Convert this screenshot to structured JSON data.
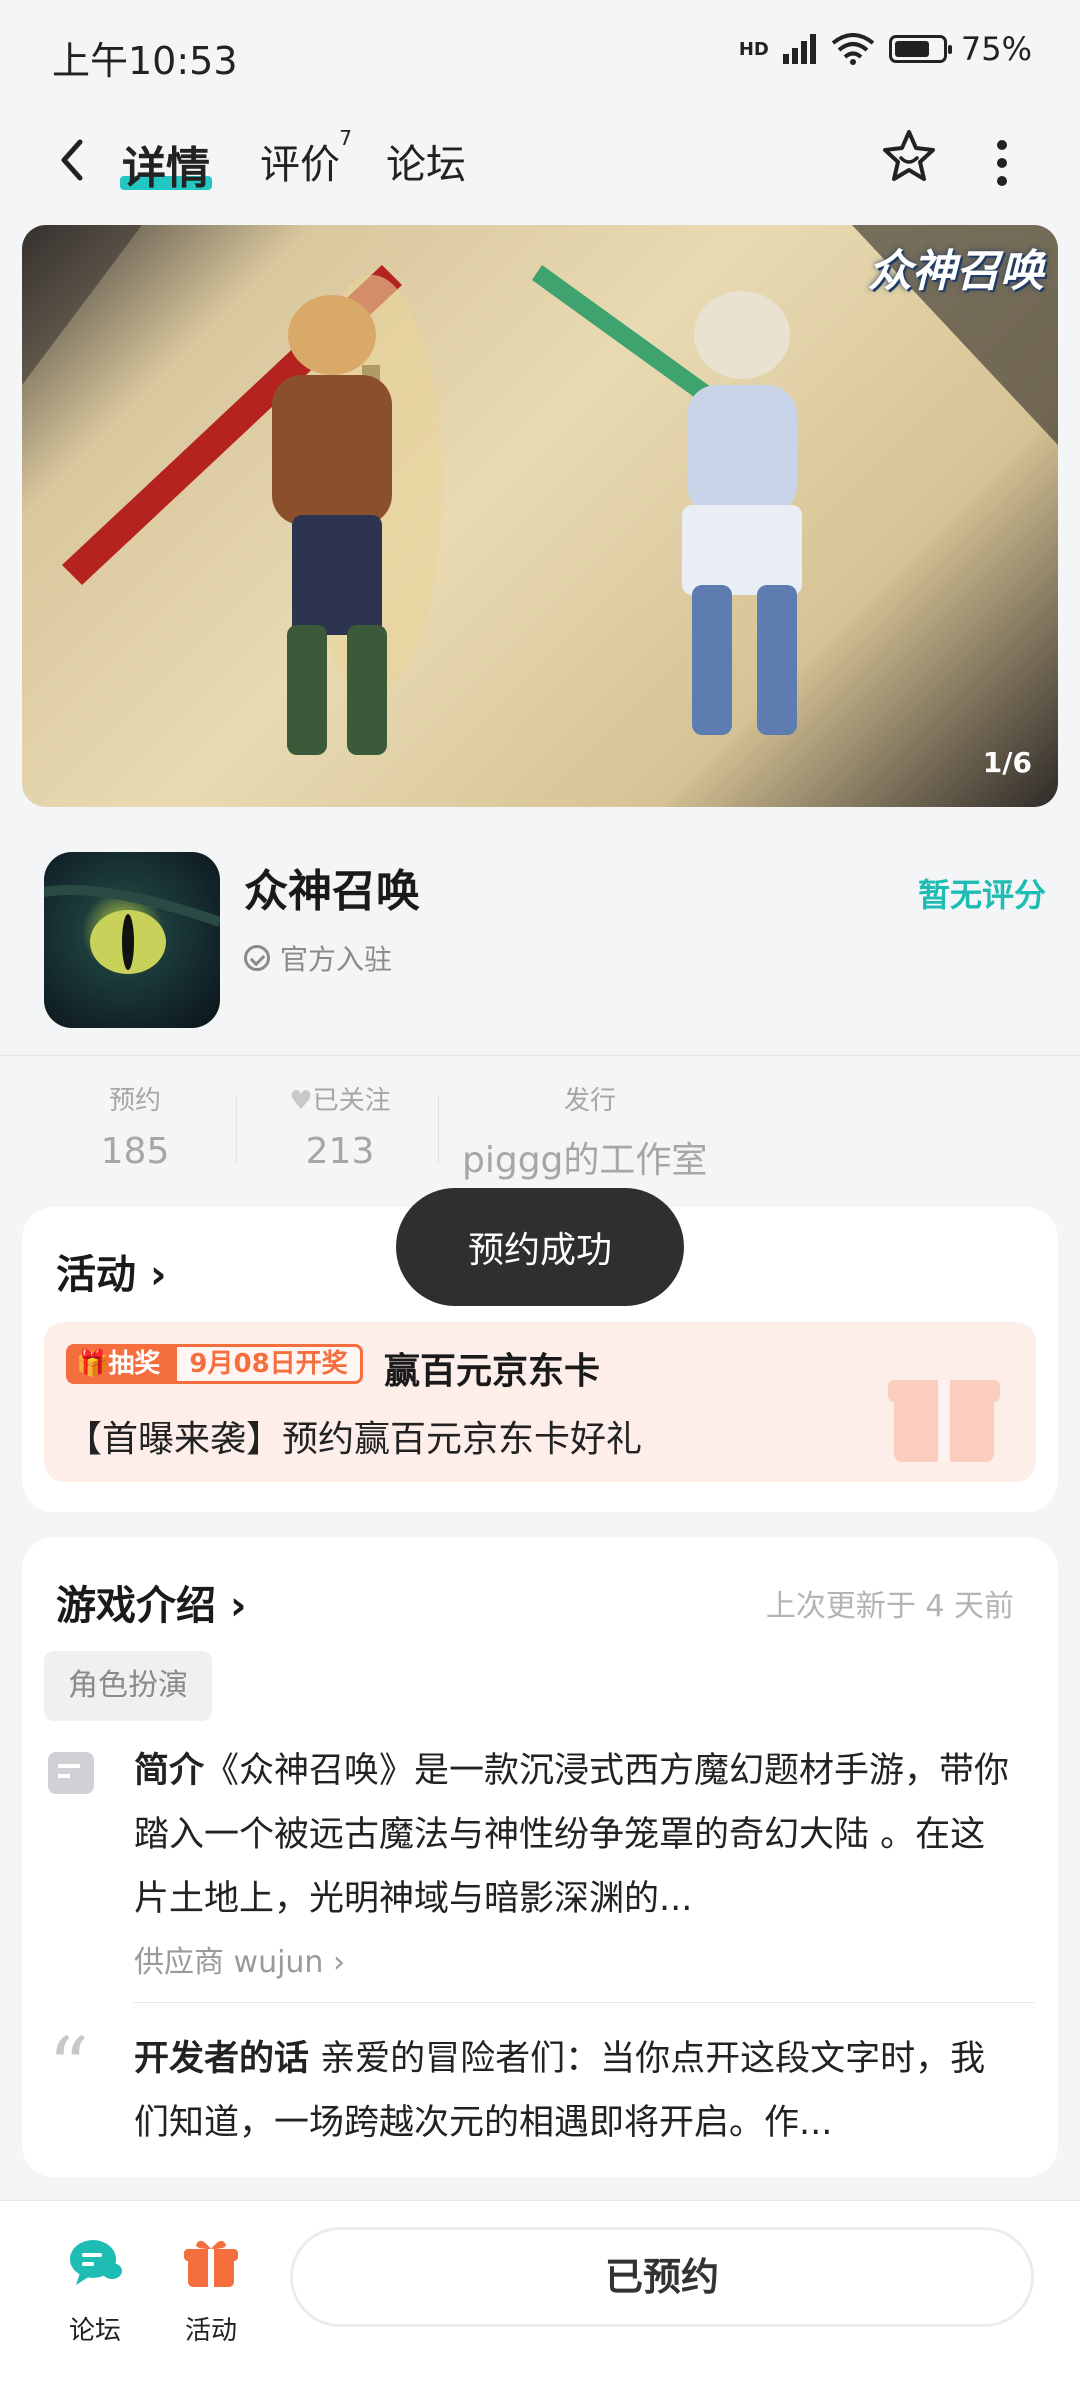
{
  "status": {
    "time": "上午10:53",
    "network": "HD",
    "battery": "75%",
    "battery_level": 0.75
  },
  "nav": {
    "tabs": [
      {
        "label": "详情",
        "active": true
      },
      {
        "label": "评价",
        "badge": "7"
      },
      {
        "label": "论坛"
      }
    ]
  },
  "banner": {
    "logo_text": "众神召唤",
    "counter": "1/6"
  },
  "app": {
    "name": "众神召唤",
    "official_label": "官方入驻",
    "rating_label": "暂无评分"
  },
  "stats": [
    {
      "label": "预约",
      "value": "185"
    },
    {
      "label": "已关注",
      "value": "213"
    },
    {
      "label": "发行",
      "value": "piggg的工作室"
    }
  ],
  "toast": "预约成功",
  "activity": {
    "title": "活动",
    "badge_type": "抽奖",
    "badge_date": "9月08日开奖",
    "prize": "赢百元京东卡",
    "description": "【首曝来袭】预约赢百元京东卡好礼"
  },
  "intro": {
    "title": "游戏介绍",
    "updated": "上次更新于 4 天前",
    "tag": "角色扮演",
    "summary_label": "简介",
    "summary_text": "《众神召唤》是一款沉浸式西方魔幻题材手游，带你踏入一个被远古魔法与神性纷争笼罩的奇幻大陆 。在这片土地上，光明神域与暗影深渊的...",
    "supplier": "供应商 wujun",
    "dev_label": "开发者的话",
    "dev_text": "亲爱的冒险者们：当你点开这段文字时，我们知道，一场跨越次元的相遇即将开启。作..."
  },
  "bottombar": {
    "forum_label": "论坛",
    "activity_label": "活动",
    "reserve_label": "已预约"
  },
  "colors": {
    "accent": "#22c7c4",
    "rating": "#1fbcb4",
    "activity_orange": "#f56e3e",
    "activity_bg": "#fdeeea",
    "toast_bg": "#2f2f2f"
  }
}
